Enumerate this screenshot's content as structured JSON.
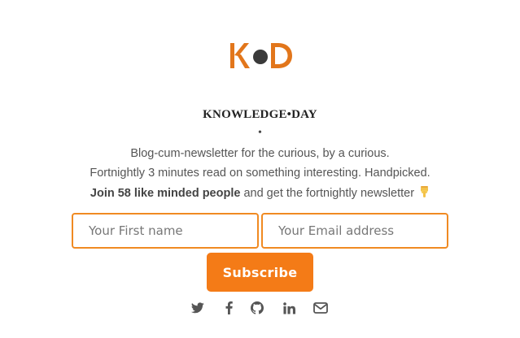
{
  "brand": {
    "logo_text": "KD",
    "title": "KNOWLEDGE•DAY",
    "separator": "•"
  },
  "description": {
    "line1": "Blog-cum-newsletter for the curious, by a curious.",
    "line2": "Fortnightly 3 minutes read on something interesting. Handpicked.",
    "join_bold": "Join 58 like minded people",
    "join_rest": " and get the fortnightly newsletter ",
    "pointer_icon": "backhand-index-pointing-down-icon"
  },
  "form": {
    "first_name_placeholder": "Your First name",
    "email_placeholder": "Your Email address",
    "subscribe_label": "Subscribe"
  },
  "social_icons": [
    "twitter-icon",
    "facebook-icon",
    "github-icon",
    "linkedin-icon",
    "envelope-icon"
  ],
  "colors": {
    "accent": "#f47b17",
    "input_border": "#f08a22",
    "logo_orange": "#e2761b",
    "logo_dot": "#3a3a3a",
    "text": "#555555",
    "icon": "#555555"
  }
}
